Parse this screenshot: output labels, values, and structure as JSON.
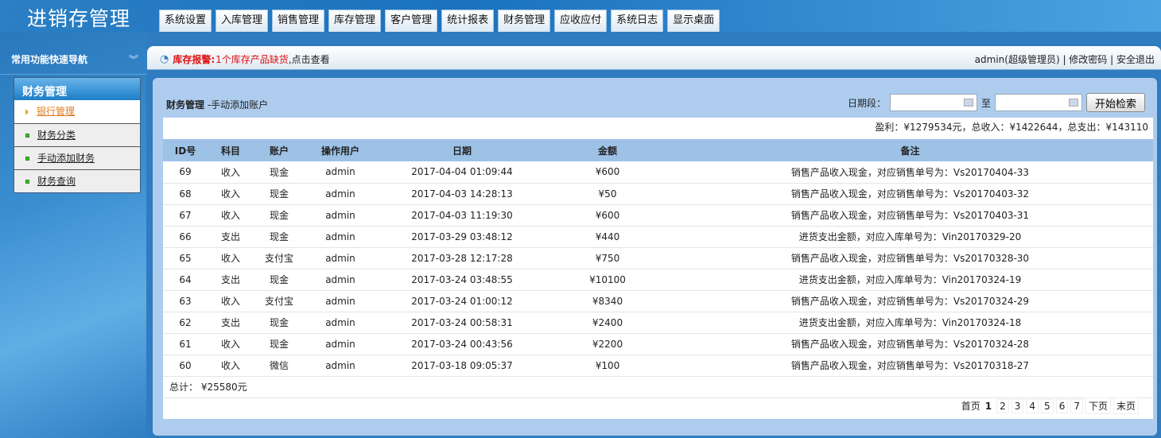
{
  "app": {
    "title": "进销存管理"
  },
  "tabs": [
    "系统设置",
    "入库管理",
    "销售管理",
    "库存管理",
    "客户管理",
    "统计报表",
    "财务管理",
    "应收应付",
    "系统日志",
    "显示桌面"
  ],
  "sidebar": {
    "title": "常用功能快速导航",
    "section": "财务管理",
    "items": [
      "银行管理",
      "财务分类",
      "手动添加财务",
      "财务查询"
    ]
  },
  "topbar": {
    "alert_label": "库存报警:",
    "alert_text": "1个库存产品缺货",
    "alert_link": ",点击查看",
    "user": "admin(超级管理员)",
    "change_pwd": "修改密码",
    "logout": "安全退出"
  },
  "page": {
    "title": "财务管理",
    "subtitle": "-手动添加账户"
  },
  "search": {
    "label": "日期段：",
    "to": "至",
    "start": "",
    "end": "",
    "button": "开始检索"
  },
  "summary": "盈利：¥1279534元，总收入：¥1422644，总支出：¥143110",
  "table": {
    "headers": [
      "ID号",
      "科目",
      "账户",
      "操作用户",
      "日期",
      "金额",
      "备注"
    ],
    "rows": [
      [
        "69",
        "收入",
        "现金",
        "admin",
        "2017-04-04 01:09:44",
        "¥600",
        "销售产品收入现金，对应销售单号为：Vs20170404-33"
      ],
      [
        "68",
        "收入",
        "现金",
        "admin",
        "2017-04-03 14:28:13",
        "¥50",
        "销售产品收入现金，对应销售单号为：Vs20170403-32"
      ],
      [
        "67",
        "收入",
        "现金",
        "admin",
        "2017-04-03 11:19:30",
        "¥600",
        "销售产品收入现金，对应销售单号为：Vs20170403-31"
      ],
      [
        "66",
        "支出",
        "现金",
        "admin",
        "2017-03-29 03:48:12",
        "¥440",
        "进货支出金额，对应入库单号为：Vin20170329-20"
      ],
      [
        "65",
        "收入",
        "支付宝",
        "admin",
        "2017-03-28 12:17:28",
        "¥750",
        "销售产品收入现金，对应销售单号为：Vs20170328-30"
      ],
      [
        "64",
        "支出",
        "现金",
        "admin",
        "2017-03-24 03:48:55",
        "¥10100",
        "进货支出金额，对应入库单号为：Vin20170324-19"
      ],
      [
        "63",
        "收入",
        "支付宝",
        "admin",
        "2017-03-24 01:00:12",
        "¥8340",
        "销售产品收入现金，对应销售单号为：Vs20170324-29"
      ],
      [
        "62",
        "支出",
        "现金",
        "admin",
        "2017-03-24 00:58:31",
        "¥2400",
        "进货支出金额，对应入库单号为：Vin20170324-18"
      ],
      [
        "61",
        "收入",
        "现金",
        "admin",
        "2017-03-24 00:43:56",
        "¥2200",
        "销售产品收入现金，对应销售单号为：Vs20170324-28"
      ],
      [
        "60",
        "收入",
        "微信",
        "admin",
        "2017-03-18 09:05:37",
        "¥100",
        "销售产品收入现金，对应销售单号为：Vs20170318-27"
      ]
    ],
    "total": "总计：  ¥25580元"
  },
  "pager": [
    "首页",
    "1",
    "2",
    "3",
    "4",
    "5",
    "6",
    "7",
    "下页",
    "末页"
  ]
}
